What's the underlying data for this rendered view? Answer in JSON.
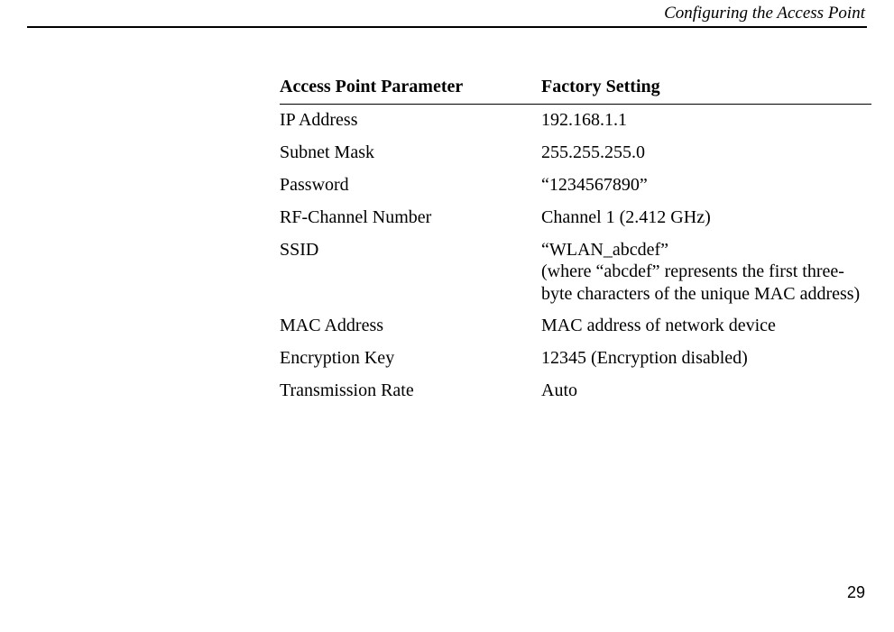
{
  "header": {
    "running_head": "Configuring the Access Point"
  },
  "table": {
    "columns": {
      "param": "Access Point Parameter",
      "setting": "Factory Setting"
    },
    "rows": [
      {
        "param": "IP Address",
        "setting": "192.168.1.1"
      },
      {
        "param": "Subnet Mask",
        "setting": "255.255.255.0"
      },
      {
        "param": "Password",
        "setting": "“1234567890”"
      },
      {
        "param": "RF-Channel Number",
        "setting": "Channel 1 (2.412 GHz)"
      },
      {
        "param": "SSID",
        "setting": "“WLAN_abcdef”\n(where “abcdef” represents the first three-byte characters of the unique MAC address)"
      },
      {
        "param": "MAC Address",
        "setting": "MAC address of network device"
      },
      {
        "param": "Encryption Key",
        "setting": "12345 (Encryption disabled)"
      },
      {
        "param": "Transmission Rate",
        "setting": "Auto"
      }
    ]
  },
  "footer": {
    "page_number": "29"
  }
}
